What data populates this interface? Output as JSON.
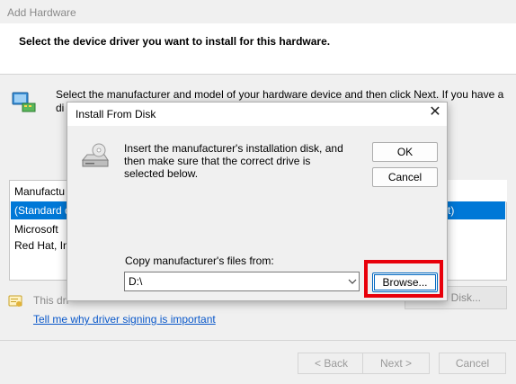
{
  "wizard": {
    "title": "Add Hardware",
    "heading": "Select the device driver you want to install for this hardware.",
    "instruction": "Select the manufacturer and model of your hardware device and then click Next. If you have a di",
    "manufacturer_list": {
      "header": "Manufactu",
      "rows": [
        "(Standard d",
        "Microsoft",
        "Red Hat, In"
      ],
      "selected_right_fragment": "t)"
    },
    "signing_text": "This dri",
    "have_disk_label": "e Disk...",
    "signing_link": "Tell me why driver signing is important",
    "buttons": {
      "back": "< Back",
      "next": "Next >",
      "cancel": "Cancel"
    }
  },
  "dialog": {
    "title": "Install From Disk",
    "close_glyph": "✕",
    "message": "Insert the manufacturer's installation disk, and then make sure that the correct drive is selected below.",
    "ok_label": "OK",
    "cancel_label": "Cancel",
    "copy_label": "Copy manufacturer's files from:",
    "path_value": "D:\\",
    "browse_label": "Browse..."
  },
  "colors": {
    "selection": "#0078d7",
    "highlight_box": "#e8000b",
    "link": "#0a58ca"
  }
}
